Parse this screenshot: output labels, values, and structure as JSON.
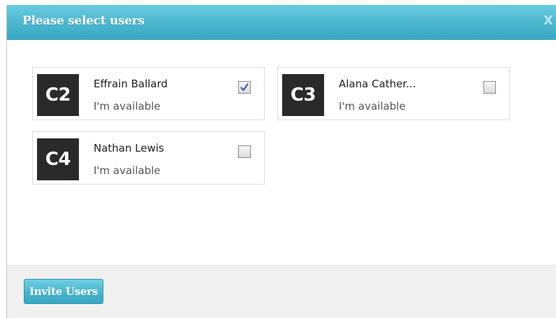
{
  "dialog": {
    "title": "Please select users",
    "close_label": "X"
  },
  "users": [
    {
      "initials": "C2",
      "name": "Effrain Ballard",
      "status": "I'm available",
      "checked": true
    },
    {
      "initials": "C3",
      "name": "Alana Cather...",
      "status": "I'm available",
      "checked": false
    },
    {
      "initials": "C4",
      "name": "Nathan Lewis",
      "status": "I'm available",
      "checked": false
    }
  ],
  "footer": {
    "invite_label": "Invite Users"
  },
  "icons": {
    "close": "close-icon",
    "check": "checkmark-icon"
  },
  "colors": {
    "accent": "#4ab6cf",
    "checkmark": "#3b5bb5",
    "avatar_bg": "#2a2a2a"
  }
}
